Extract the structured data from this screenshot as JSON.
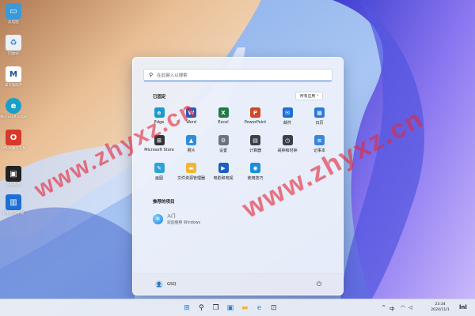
{
  "desktop": {
    "icons": [
      {
        "label": "此电脑",
        "icon": "monitor-icon",
        "color": "#3a9ad9"
      },
      {
        "label": "回收站",
        "icon": "recycle-bin-icon",
        "color": "#e8f0f8"
      },
      {
        "label": "知识兔助手",
        "icon": "app-logo-icon",
        "color": "#1d4fa8"
      },
      {
        "label": "Microsoft Edge",
        "icon": "edge-icon",
        "color": "#1aa0c8"
      },
      {
        "label": "Office激活工具",
        "icon": "office-icon",
        "color": "#d8392b"
      },
      {
        "label": "系统截图",
        "icon": "screenshot-icon",
        "color": "#222222"
      },
      {
        "label": "新机用户手册",
        "icon": "manual-icon",
        "color": "#1d6fd6"
      }
    ]
  },
  "start_menu": {
    "search_placeholder": "在此键入以搜索",
    "pinned_title": "已固定",
    "all_apps_label": "所有应用",
    "all_apps_chevron": "›",
    "pinned_apps": [
      {
        "label": "Edge",
        "icon": "edge-icon",
        "color": "#1a9bd0",
        "glyph": "e"
      },
      {
        "label": "Word",
        "icon": "word-icon",
        "color": "#2b5bb8",
        "glyph": "W"
      },
      {
        "label": "Excel",
        "icon": "excel-icon",
        "color": "#1f7a45",
        "glyph": "X"
      },
      {
        "label": "PowerPoint",
        "icon": "powerpoint-icon",
        "color": "#d24726",
        "glyph": "P"
      },
      {
        "label": "邮件",
        "icon": "mail-icon",
        "color": "#1d6fd6",
        "glyph": "✉"
      },
      {
        "label": "日历",
        "icon": "calendar-icon",
        "color": "#2a79d8",
        "glyph": "▦"
      },
      {
        "label": "Microsoft Store",
        "icon": "store-icon",
        "color": "#333333",
        "glyph": "⊞"
      },
      {
        "label": "照片",
        "icon": "photos-icon",
        "color": "#2a8ee0",
        "glyph": "▲"
      },
      {
        "label": "设置",
        "icon": "gear-icon",
        "color": "#6b7380",
        "glyph": "⚙"
      },
      {
        "label": "计算器",
        "icon": "calculator-icon",
        "color": "#3b3f47",
        "glyph": "▤"
      },
      {
        "label": "闹钟和时钟",
        "icon": "clock-icon",
        "color": "#3b3f47",
        "glyph": "◷"
      },
      {
        "label": "记事本",
        "icon": "notepad-icon",
        "color": "#3b86d8",
        "glyph": "≡"
      },
      {
        "label": "画图",
        "icon": "paint-icon",
        "color": "#2fa3d6",
        "glyph": "✎"
      },
      {
        "label": "文件资源管理器",
        "icon": "folder-icon",
        "color": "#f2b632",
        "glyph": "▬"
      },
      {
        "label": "电影和电视",
        "icon": "movies-icon",
        "color": "#1b5fbf",
        "glyph": "▶"
      },
      {
        "label": "使用技巧",
        "icon": "tips-icon",
        "color": "#1c8ddb",
        "glyph": "◉"
      }
    ],
    "recommended_title": "推荐的项目",
    "recommended": [
      {
        "name": "入门",
        "sub": "欢迎使用 Windows",
        "icon": "get-started-icon",
        "glyph": "✲"
      }
    ],
    "user_name": "GSQ",
    "avatar_glyph": "👤",
    "power_glyph": "⏻"
  },
  "watermark_text": "www.zhyxz.cn",
  "taskbar": {
    "icons": [
      {
        "name": "start-button",
        "glyph": "⊞",
        "color": "#1e7be0"
      },
      {
        "name": "taskbar-search-button",
        "glyph": "⚲",
        "color": "#222222"
      },
      {
        "name": "task-view-button",
        "glyph": "❐",
        "color": "#222222"
      },
      {
        "name": "widgets-button",
        "glyph": "▣",
        "color": "#2b7bd8"
      },
      {
        "name": "file-explorer-button",
        "glyph": "▬",
        "color": "#f2b632"
      },
      {
        "name": "edge-button",
        "glyph": "e",
        "color": "#1a9bd0"
      },
      {
        "name": "store-button",
        "glyph": "⊡",
        "color": "#333333"
      }
    ],
    "tray": {
      "chevron": "^",
      "ime": "中",
      "network": "◠",
      "volume": "◁",
      "time": "23:34",
      "date": "2024/11/1",
      "logo": "lnl"
    }
  }
}
